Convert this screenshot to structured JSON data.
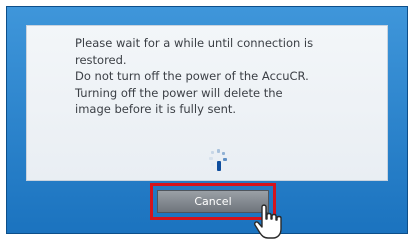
{
  "dialog": {
    "message_lines": [
      "Please wait for a while until connection is",
      "restored.",
      "Do not turn off the power of the AccuCR.",
      "Turning off the power will delete the",
      "image before it is fully sent."
    ],
    "cancel_label": "Cancel"
  },
  "icons": {
    "spinner": "loading-spinner-icon",
    "pointer": "hand-pointer-icon"
  },
  "colors": {
    "frame": "#1f7ac6",
    "panel": "#eef2f6",
    "highlight": "#d4141c",
    "button": "#7b8188"
  }
}
